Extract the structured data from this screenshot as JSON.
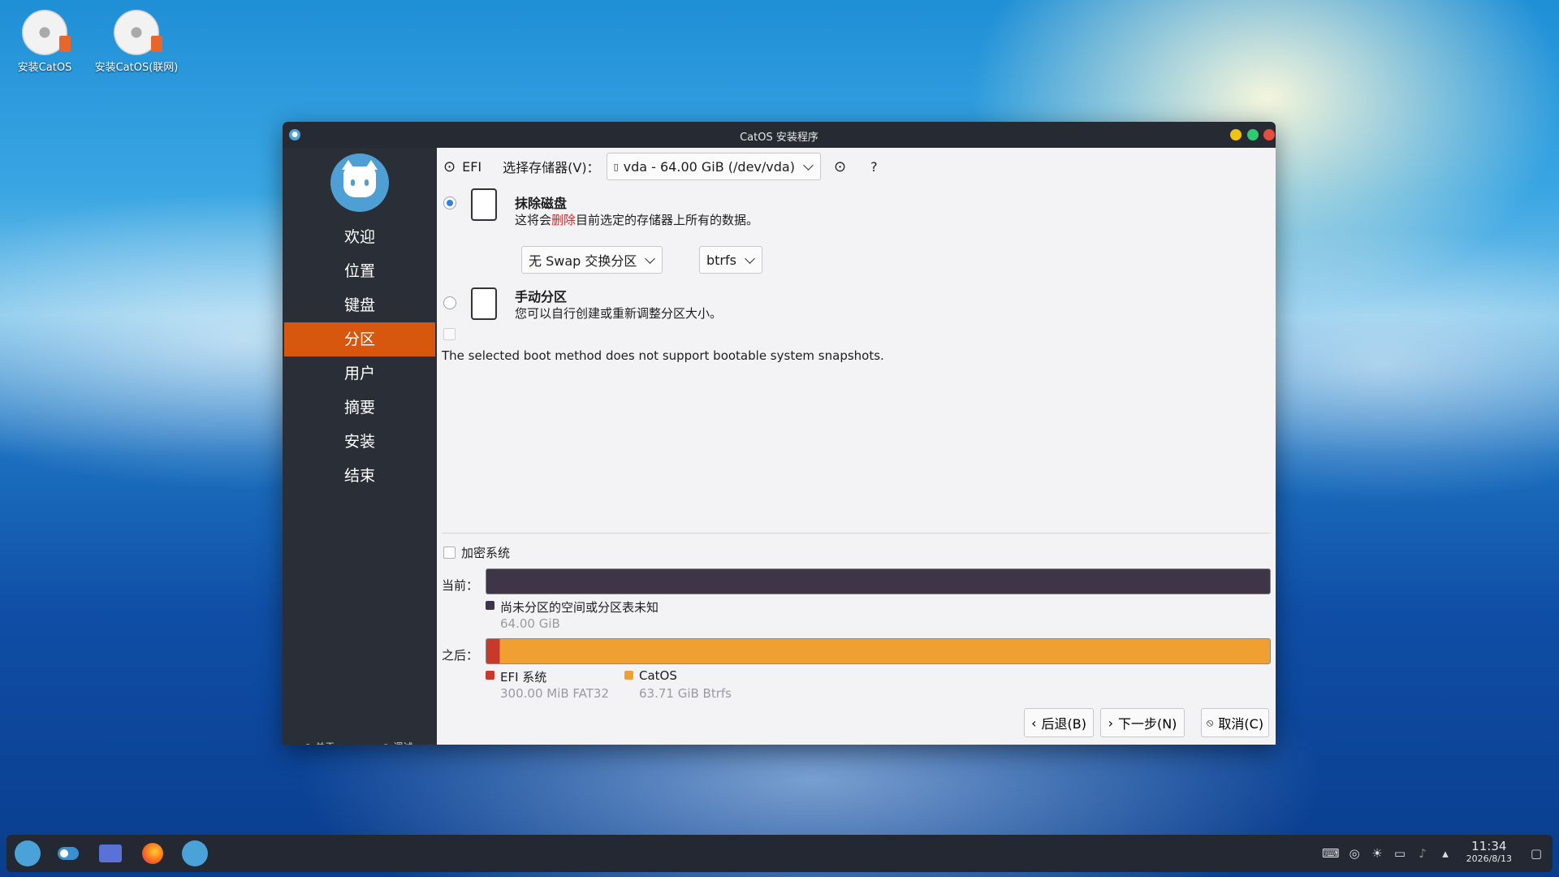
{
  "desktop": {
    "icons": [
      {
        "label": "安装CatOS"
      },
      {
        "label": "安装CatOS(联网)"
      }
    ]
  },
  "window": {
    "title": "CatOS 安装程序"
  },
  "sidebar": {
    "items": [
      {
        "label": "欢迎"
      },
      {
        "label": "位置"
      },
      {
        "label": "键盘"
      },
      {
        "label": "分区",
        "active": true
      },
      {
        "label": "用户"
      },
      {
        "label": "摘要"
      },
      {
        "label": "安装"
      },
      {
        "label": "结束"
      }
    ],
    "footer": {
      "about": "关于",
      "debug": "调试"
    }
  },
  "partition": {
    "boot_mode": "EFI",
    "storage_label": "选择存储器(V)：",
    "storage_value": "vda - 64.00 GiB (/dev/vda)",
    "help": "?",
    "erase": {
      "title": "抹除磁盘",
      "desc_pre": "这将会",
      "desc_red": "删除",
      "desc_post": "目前选定的存储器上所有的数据。",
      "swap_value": "无 Swap 交换分区",
      "fs_value": "btrfs",
      "selected": true
    },
    "manual": {
      "title": "手动分区",
      "desc": "您可以自行创建或重新调整分区大小。"
    },
    "snapshot_note": "The selected boot method does not support bootable system snapshots.",
    "encrypt_label": "加密系统",
    "current_label": "当前：",
    "after_label": "之后：",
    "current_legend": {
      "name": "尚未分区的空间或分区表未知",
      "size": "64.00 GiB",
      "color": "#3f3548"
    },
    "after_legend": [
      {
        "name": "EFI 系统",
        "size": "300.00 MiB  FAT32",
        "color": "#c8392b"
      },
      {
        "name": "CatOS",
        "size": "63.71 GiB  Btrfs",
        "color": "#f0a030"
      }
    ]
  },
  "buttons": {
    "back": "后退(B)",
    "next": "下一步(N)",
    "cancel": "取消(C)"
  },
  "taskbar": {
    "time": "11:34",
    "date": "2026/8/13"
  }
}
